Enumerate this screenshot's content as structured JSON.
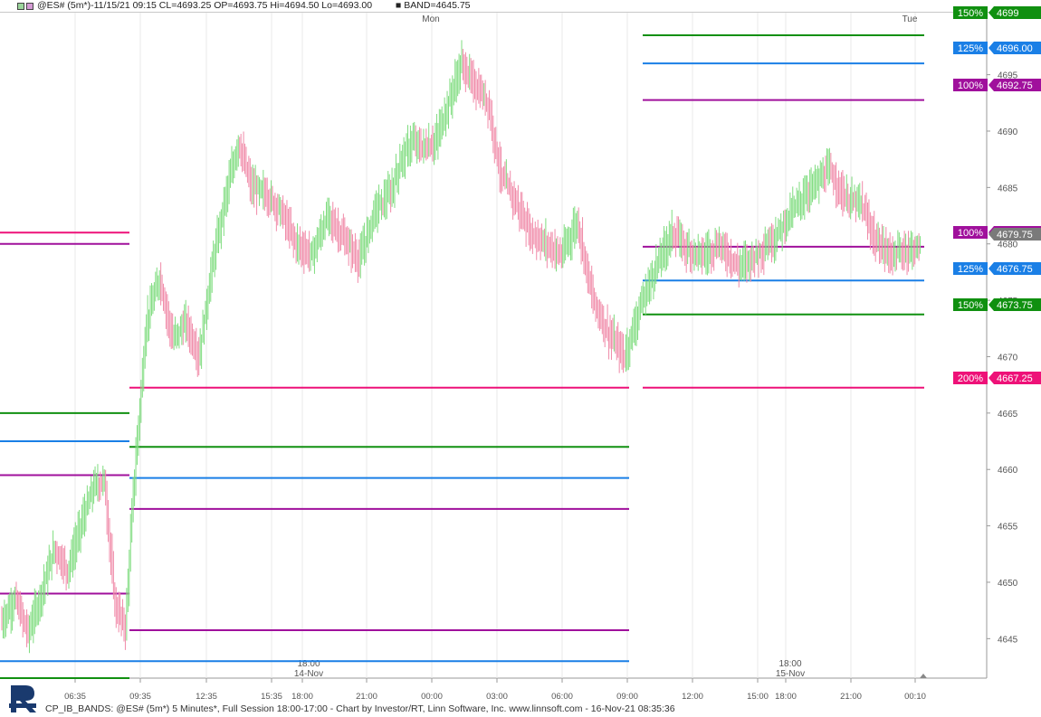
{
  "header": {
    "symbol_text": "@ES# (5m*)-11/15/21 09:15 CL=4693.25 OP=4693.75 Hi=4694.50 Lo=4693.00",
    "band_text": "BAND=4645.75"
  },
  "footer": {
    "text": "CP_IB_BANDS: @ES# (5m*) 5 Minutes*, Full Session 18:00-17:00 - Chart by Investor/RT, Linn Software, Inc. www.linnsoft.com - 16-Nov-21 08:35:36"
  },
  "colors": {
    "up_bar": "#7fdc7f",
    "down_bar": "#f08aa8",
    "purple": "#a0109c",
    "blue": "#1a7fe6",
    "green": "#109010",
    "pink": "#ee1178",
    "axis_text": "#555555",
    "grid": "#e8e8e8"
  },
  "chart_data": {
    "type": "line",
    "title": "",
    "ylim": [
      4641.5,
      4700.5
    ],
    "y_ticks": [
      4645,
      4650,
      4655,
      4660,
      4665,
      4670,
      4675,
      4680,
      4685,
      4690,
      4695
    ],
    "x_tick_labels": [
      "06:35",
      "09:35",
      "12:35",
      "15:35",
      "18:00",
      "21:00",
      "00:00",
      "03:00",
      "06:00",
      "09:00",
      "12:00",
      "15:00",
      "18:00",
      "21:00",
      "00:10"
    ],
    "day_labels": [
      "Mon",
      "Tue"
    ],
    "session_labels": [
      {
        "time": "18:00",
        "date": "14-Nov"
      },
      {
        "time": "18:00",
        "date": "15-Nov"
      }
    ],
    "price_series": {
      "name": "",
      "bar_index": [
        0,
        10,
        20,
        30,
        40,
        50,
        60,
        70,
        78,
        86,
        94,
        100,
        110,
        120,
        130,
        140,
        150,
        160,
        170,
        180,
        190,
        200,
        212,
        224,
        236,
        248,
        260,
        272,
        284,
        296,
        304,
        312,
        320,
        330,
        340,
        350,
        360,
        370,
        380,
        390,
        402,
        414,
        426,
        438,
        450,
        462,
        474,
        486,
        498,
        510,
        522,
        534,
        546,
        560,
        574,
        588,
        602,
        616,
        630,
        642,
        654,
        666,
        678,
        690,
        700
      ],
      "close": [
        4646.5,
        4648.5,
        4645.5,
        4649.0,
        4653.0,
        4651.0,
        4655.0,
        4658.5,
        4659.0,
        4648.0,
        4646.0,
        4658.0,
        4673.0,
        4677.0,
        4671.5,
        4673.0,
        4670.0,
        4678.0,
        4684.0,
        4689.0,
        4685.0,
        4684.5,
        4683.0,
        4680.0,
        4679.0,
        4682.5,
        4680.5,
        4678.5,
        4683.0,
        4684.5,
        4687.5,
        4689.0,
        4688.5,
        4689.0,
        4692.5,
        4696.0,
        4694.0,
        4692.5,
        4686.0,
        4684.0,
        4681.0,
        4680.0,
        4679.0,
        4682.0,
        4675.0,
        4672.0,
        4670.0,
        4674.5,
        4678.0,
        4681.0,
        4679.5,
        4679.0,
        4680.0,
        4678.0,
        4679.0,
        4680.5,
        4683.0,
        4685.0,
        4686.5,
        4684.0,
        4683.5,
        4680.0,
        4679.0,
        4679.5,
        4679.75
      ]
    },
    "bands": [
      {
        "segment": 1,
        "color": "purple",
        "value": 4680.0
      },
      {
        "segment": 1,
        "color": "pink",
        "value": 4681.0
      },
      {
        "segment": 1,
        "color": "green",
        "value": 4665.0
      },
      {
        "segment": 1,
        "color": "blue",
        "value": 4662.5
      },
      {
        "segment": 1,
        "color": "purple",
        "value": 4659.5
      },
      {
        "segment": 1,
        "color": "purple",
        "value": 4649.0
      },
      {
        "segment": 1,
        "color": "blue",
        "value": 4643.0
      },
      {
        "segment": 1,
        "color": "green",
        "value": 4641.5
      },
      {
        "segment": 2,
        "color": "pink",
        "value": 4667.25
      },
      {
        "segment": 2,
        "color": "green",
        "value": 4662.0
      },
      {
        "segment": 2,
        "color": "blue",
        "value": 4659.25
      },
      {
        "segment": 2,
        "color": "purple",
        "value": 4656.5
      },
      {
        "segment": 2,
        "color": "purple",
        "value": 4645.75
      },
      {
        "segment": 2,
        "color": "blue",
        "value": 4643.0
      },
      {
        "segment": 3,
        "color": "green",
        "value": 4698.5
      },
      {
        "segment": 3,
        "color": "blue",
        "value": 4696.0
      },
      {
        "segment": 3,
        "color": "purple",
        "value": 4692.75
      },
      {
        "segment": 3,
        "color": "purple",
        "value": 4679.75
      },
      {
        "segment": 3,
        "color": "blue",
        "value": 4676.75
      },
      {
        "segment": 3,
        "color": "green",
        "value": 4673.75
      },
      {
        "segment": 3,
        "color": "pink",
        "value": 4667.25
      }
    ],
    "band_labels": [
      {
        "pct": "150%",
        "value": "4699",
        "color": "green"
      },
      {
        "pct": "125%",
        "value": "4696.00",
        "color": "blue"
      },
      {
        "pct": "100%",
        "value": "4692.75",
        "color": "purple"
      },
      {
        "pct": "100%",
        "value": "4679.75",
        "color": "purple"
      },
      {
        "pct": "125%",
        "value": "4676.75",
        "color": "blue"
      },
      {
        "pct": "150%",
        "value": "4673.75",
        "color": "green"
      },
      {
        "pct": "200%",
        "value": "4667.25",
        "color": "pink"
      }
    ],
    "last_price": "4679.75"
  }
}
